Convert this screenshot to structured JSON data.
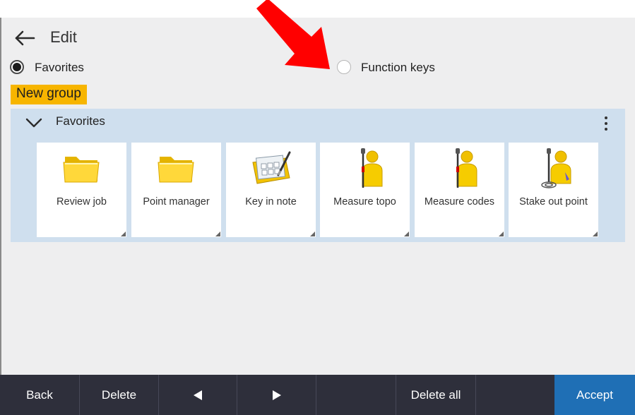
{
  "header": {
    "title": "Edit",
    "back_icon": "arrow-left-icon"
  },
  "mode_options": {
    "favorites_label": "Favorites",
    "favorites_selected": true,
    "function_keys_label": "Function keys",
    "function_keys_selected": false
  },
  "new_group_label": "New group",
  "group": {
    "title": "Favorites",
    "expanded": true,
    "menu_icon": "more-vertical-icon",
    "tiles": [
      {
        "label": "Review job",
        "icon": "folder-icon"
      },
      {
        "label": "Point manager",
        "icon": "folder-icon"
      },
      {
        "label": "Key in note",
        "icon": "note-keypad-icon"
      },
      {
        "label": "Measure topo",
        "icon": "surveyor-pole-icon"
      },
      {
        "label": "Measure codes",
        "icon": "surveyor-pole-icon"
      },
      {
        "label": "Stake out point",
        "icon": "surveyor-stakeout-icon"
      }
    ]
  },
  "footer": {
    "back_label": "Back",
    "delete_label": "Delete",
    "prev_icon": "triangle-left-icon",
    "next_icon": "triangle-right-icon",
    "delete_all_label": "Delete all",
    "accept_label": "Accept",
    "accept_color": "#1f6fb5"
  },
  "annotation": {
    "icon": "red-pointer-arrow",
    "color": "#ff0000"
  },
  "colors": {
    "new_group_bg": "#f7b500",
    "group_panel_bg": "#cfdfee",
    "footer_bg": "#2e2f3b"
  }
}
